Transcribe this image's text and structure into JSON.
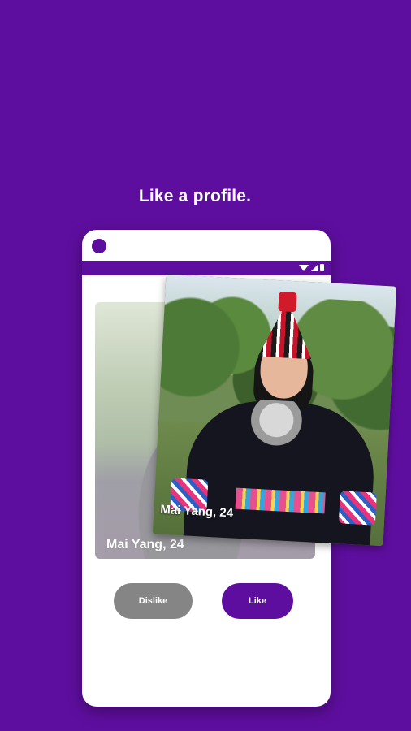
{
  "headline": "Like a profile.",
  "card_back": {
    "name": "Mai Yang, 24"
  },
  "card_front": {
    "name": "Mai Yang, 24"
  },
  "buttons": {
    "dislike": "Dislike",
    "like": "Like"
  },
  "colors": {
    "brand": "#5e0e9e",
    "dislike": "#858585",
    "card_bg": "#ffffff"
  }
}
